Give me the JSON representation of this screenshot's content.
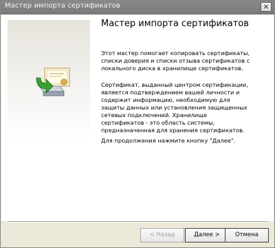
{
  "window": {
    "title": "Мастер импорта сертификатов",
    "close_label": "×"
  },
  "wizard": {
    "heading": "Мастер импорта сертификатов",
    "paragraphs": [
      "Этот мастер помогает копировать сертификаты, списки доверия и списки отзыва сертификатов с локального диска в хранилище сертификатов.",
      "Сертификат, выданный центром сертификации, является подтверждением вашей личности и содержит информацию, необходимую для защиты данных или установления защищенных сетевых подключений. Хранилище сертификатов - это область системы, предназначенная для хранения сертификатов.",
      "Для продолжения нажмите кнопку \"Далее\"."
    ]
  },
  "buttons": {
    "back": "< Назад",
    "next": "Далее >",
    "cancel": "Отмена"
  },
  "colors": {
    "titlebar": "#7a7a7a",
    "accent_green": "#3aa032"
  }
}
